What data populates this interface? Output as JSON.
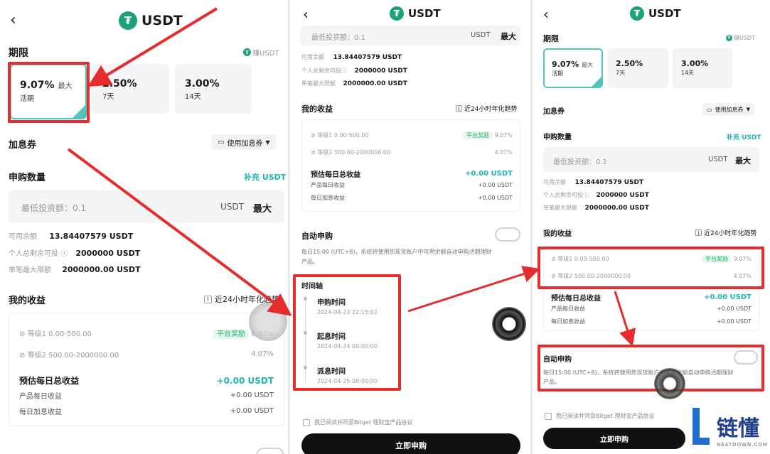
{
  "common": {
    "title": "USDT",
    "back_icon": "chevron-left-icon",
    "logo_icon": "tether-logo-icon"
  },
  "p1": {
    "period_label": "期限",
    "earn_label": "赚USDT",
    "terms": [
      {
        "pct": "9.07%",
        "max": "最大",
        "label": "活期",
        "selected": true
      },
      {
        "pct": "2.50%",
        "max": "",
        "label": "7天",
        "selected": false
      },
      {
        "pct": "3.00%",
        "max": "",
        "label": "14天",
        "selected": false
      }
    ],
    "coupon_label": "加息券",
    "coupon_button": "使用加息券",
    "amount_label": "申购数量",
    "topup": "补充 USDT",
    "input_placeholder": "最低投资额：0.1",
    "input_unit": "USDT",
    "input_max": "最大",
    "avail_label": "可用余额",
    "avail_value": "13.84407579 USDT",
    "remaining_label": "个人总剩余可投",
    "remaining_value": "2000000 USDT",
    "single_max_label": "单笔最大限额",
    "single_max_value": "2000000.00 USDT",
    "earnings_label": "我的收益",
    "trend_label": "近24小时年化趋势",
    "tier1": "等级1 0.00-500.00",
    "tier1_badge": "平台奖励",
    "tier1_rate": "9.07%",
    "tier2": "等级2 500.00-2000000.00",
    "tier2_rate": "4.07%",
    "daily_total_label": "预估每日总收益",
    "daily_total_value": "+0.00 USDT",
    "product_daily_label": "产品每日收益",
    "product_daily_value": "+0.00 USDT",
    "boost_daily_label": "每日加息收益",
    "boost_daily_value": "+0.00 USDT"
  },
  "p2": {
    "input_placeholder": "最低投资额：0.1",
    "input_unit": "USDT",
    "input_max": "最大",
    "avail_label": "可用余额",
    "avail_value": "13.84407579 USDT",
    "remaining_label": "个人总剩余可投",
    "remaining_value": "2000000 USDT",
    "single_max_label": "单笔最大限额",
    "single_max_value": "2000000.00 USDT",
    "earnings_label": "我的收益",
    "trend_label": "近24小时年化趋势",
    "tier1": "等级1 0.00-500.00",
    "tier1_badge": "平台奖励",
    "tier1_rate": "9.07%",
    "tier2": "等级2 500.00-2000000.00",
    "tier2_rate": "4.07%",
    "daily_total_label": "预估每日总收益",
    "daily_total_value": "+0.00 USDT",
    "product_daily_label": "产品每日收益",
    "product_daily_value": "+0.00 USDT",
    "boost_daily_label": "每日加息收益",
    "boost_daily_value": "+0.00 USDT",
    "auto_label": "自动申购",
    "auto_desc1": "每日15:00 (UTC+8)，系统将使用您现货账户中可用余额自动申购活期理财",
    "auto_desc2": "产品。",
    "timeline_label": "时间轴",
    "tl1_title": "申购时间",
    "tl1_time": "2024-04-23 22:15:02",
    "tl2_title": "起息时间",
    "tl2_time": "2024-04-24 00:00:00",
    "tl3_title": "派息时间",
    "tl3_time": "2024-04-25 08:00:00",
    "agree_text": "我已阅读并同意Bitget 理财宝产品协议",
    "submit": "立即申购"
  },
  "p3": {
    "period_label": "期限",
    "earn_label": "赚USDT",
    "terms": [
      {
        "pct": "9.07%",
        "max": "最大",
        "label": "活期",
        "selected": true
      },
      {
        "pct": "2.50%",
        "max": "",
        "label": "7天",
        "selected": false
      },
      {
        "pct": "3.00%",
        "max": "",
        "label": "14天",
        "selected": false
      }
    ],
    "coupon_label": "加息券",
    "coupon_button": "使用加息券",
    "amount_label": "申购数量",
    "topup": "补充 USDT",
    "input_placeholder": "最低投资额：0.1",
    "input_unit": "USDT",
    "input_max": "最大",
    "avail_label": "可用余额",
    "avail_value": "13.84407579 USDT",
    "remaining_label": "个人总剩余可投",
    "remaining_value": "2000000 USDT",
    "single_max_label": "单笔最大限额",
    "single_max_value": "2000000.00 USDT",
    "earnings_label": "我的收益",
    "trend_label": "近24小时年化趋势",
    "tier1": "等级1 0.00-500.00",
    "tier1_badge": "平台奖励",
    "tier1_rate": "9.07%",
    "tier2": "等级2 500.00-2000000.00",
    "tier2_rate": "4.07%",
    "daily_total_label": "预估每日总收益",
    "daily_total_value": "+0.00 USDT",
    "product_daily_label": "产品每日收益",
    "product_daily_value": "+0.00 USDT",
    "boost_daily_label": "每日加息收益",
    "boost_daily_value": "+0.00 USDT",
    "auto_label": "自动申购",
    "auto_desc1": "每日15:00 (UTC+8)，系统将使用您现货账户中可用余额自动申购活期理财",
    "auto_desc2": "产品。",
    "agree_text": "我已阅读并同意Bitget 理财宝产品协议",
    "submit": "立即申购"
  },
  "watermark": {
    "brand": "链懂",
    "url": "NEATDOWN.COM"
  },
  "colors": {
    "highlight": "#e52d2d",
    "accent": "#1db7b0",
    "tether": "#1ba27a"
  }
}
